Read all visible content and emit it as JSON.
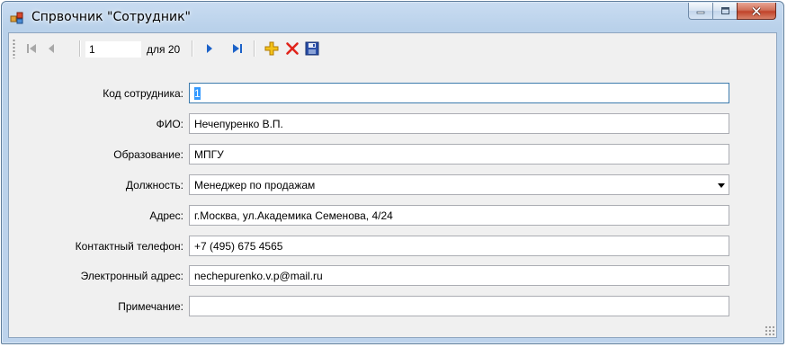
{
  "window": {
    "title": "Спрвочник \"Сотрудник\""
  },
  "navigator": {
    "position": "1",
    "count_label": "для 20"
  },
  "form": {
    "employee_code": {
      "label": "Код сотрудника:",
      "value": "1"
    },
    "full_name": {
      "label": "ФИО:",
      "value": "Нечепуренко В.П."
    },
    "education": {
      "label": "Образование:",
      "value": "МПГУ"
    },
    "position": {
      "label": "Должность:",
      "value": "Менеджер по продажам"
    },
    "address": {
      "label": "Адрес:",
      "value": "г.Москва, ул.Академика Семенова, 4/24"
    },
    "phone": {
      "label": "Контактный телефон:",
      "value": "+7 (495) 675 4565"
    },
    "email": {
      "label": "Электронный адрес:",
      "value": "nechepurenko.v.p@mail.ru"
    },
    "note": {
      "label": "Примечание:",
      "value": ""
    }
  },
  "colors": {
    "titlebar": "#c9dcf1",
    "close_button": "#c0442a",
    "add_icon": "#f0b400",
    "delete_icon": "#e0241b",
    "save_icon": "#2b4fa8",
    "nav_arrow_active": "#1c62c8",
    "selection": "#3399ff"
  },
  "icons": [
    "app-icon",
    "move-first-icon",
    "move-previous-icon",
    "move-next-icon",
    "move-last-icon",
    "add-icon",
    "delete-icon",
    "save-icon",
    "minimize-icon",
    "maximize-icon",
    "close-icon",
    "chevron-down-icon"
  ]
}
